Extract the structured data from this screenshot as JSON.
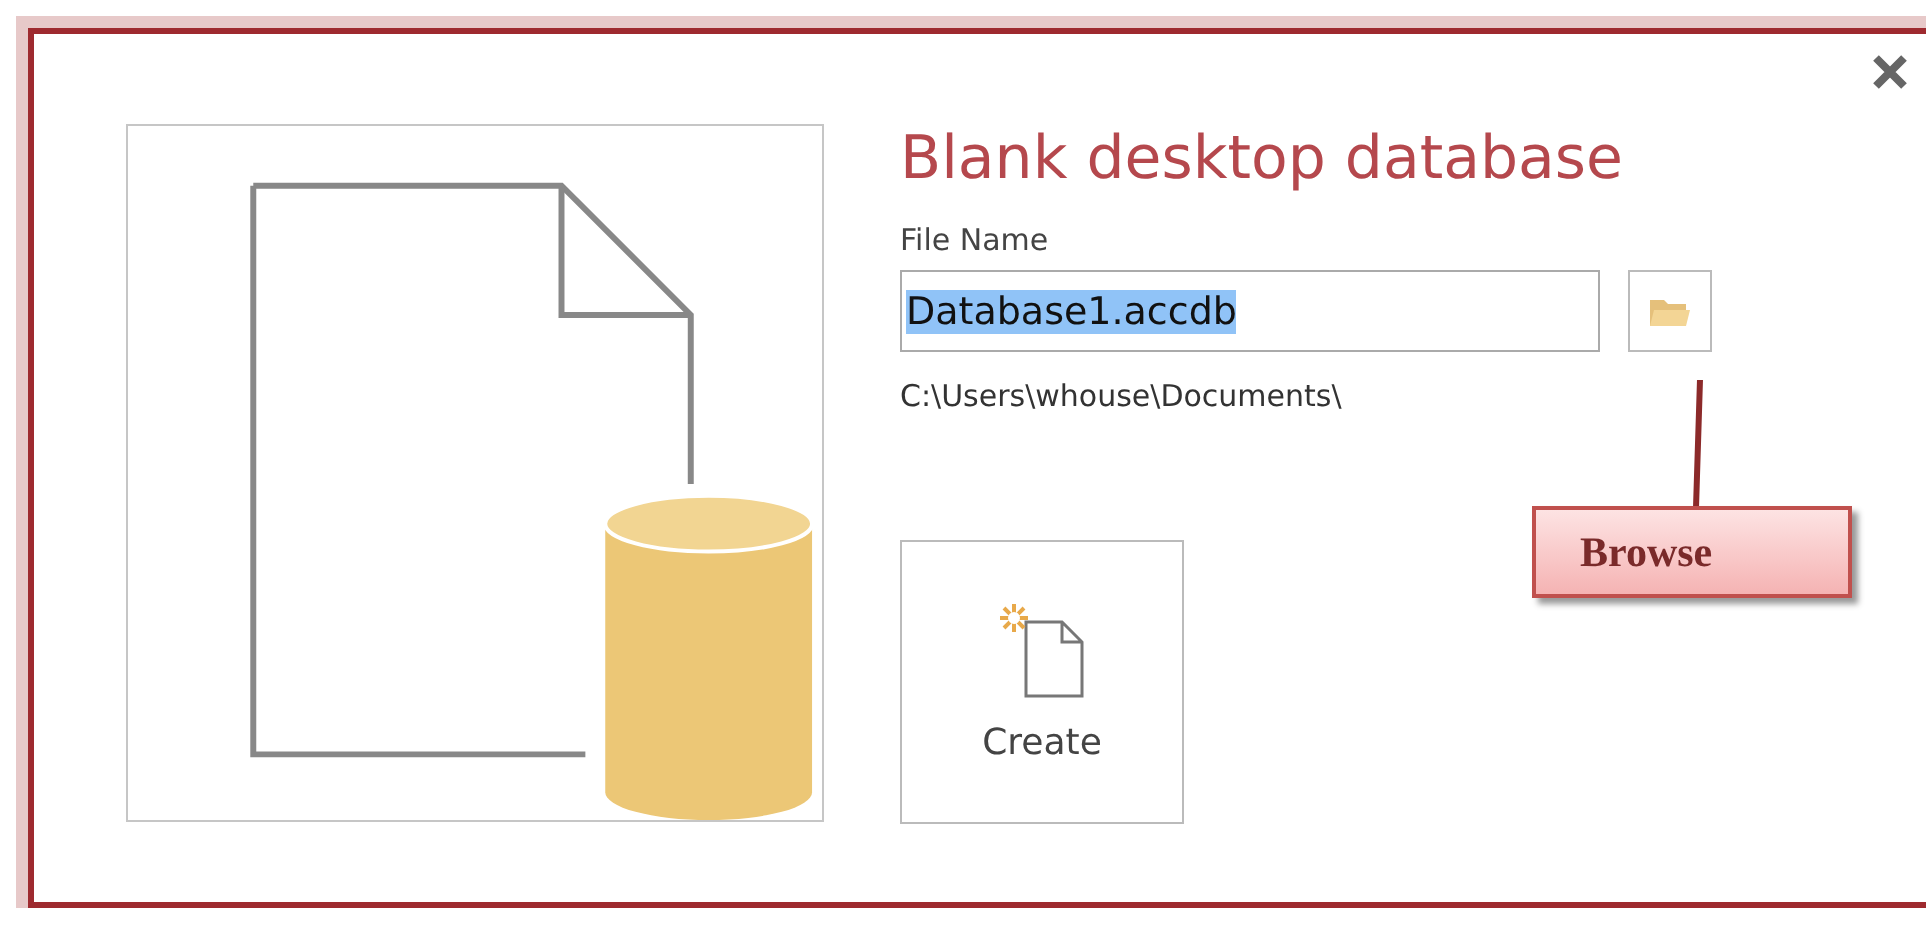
{
  "dialog": {
    "title": "Blank desktop database"
  },
  "file_name": {
    "label": "File Name",
    "value": "Database1.accdb",
    "value_selected": true
  },
  "path": "C:\\Users\\whouse\\Documents\\",
  "create_button": {
    "label": "Create"
  },
  "callout": {
    "text": "Browse"
  }
}
